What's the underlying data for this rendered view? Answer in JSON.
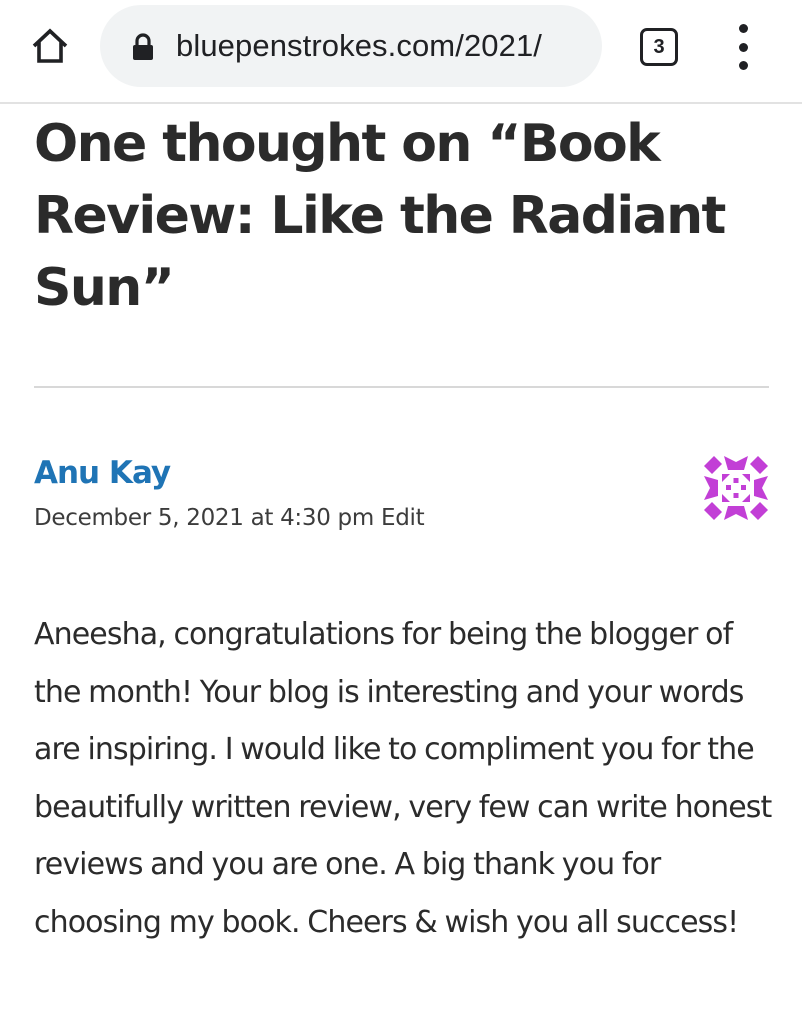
{
  "browser": {
    "url": "bluepenstrokes.com/2021/",
    "tab_count": "3",
    "icons": {
      "home": "home-icon",
      "lock": "lock-icon",
      "tabs": "tab-switcher-icon",
      "menu": "more-vert-icon"
    }
  },
  "comments": {
    "title": "One thought on “Book Review: Like the Radiant Sun”",
    "items": [
      {
        "author": "Anu Kay",
        "date": "December 5, 2021 at 4:30 pm",
        "edit_label": "Edit",
        "avatar": "identicon-avatar",
        "avatar_color": "#c23fd6",
        "text": "Aneesha, congratulations for being the blogger of the month! Your blog is interesting and your words are inspiring. I would like to compliment you for the beautifully written review, very few can write honest reviews and you are one. A big thank you for choosing my book. Cheers & wish you all success!"
      }
    ]
  },
  "colors": {
    "link": "#1f74b5",
    "text": "#2b2b2b",
    "chrome_pill": "#f1f3f4",
    "divider": "#d8d8d8"
  }
}
